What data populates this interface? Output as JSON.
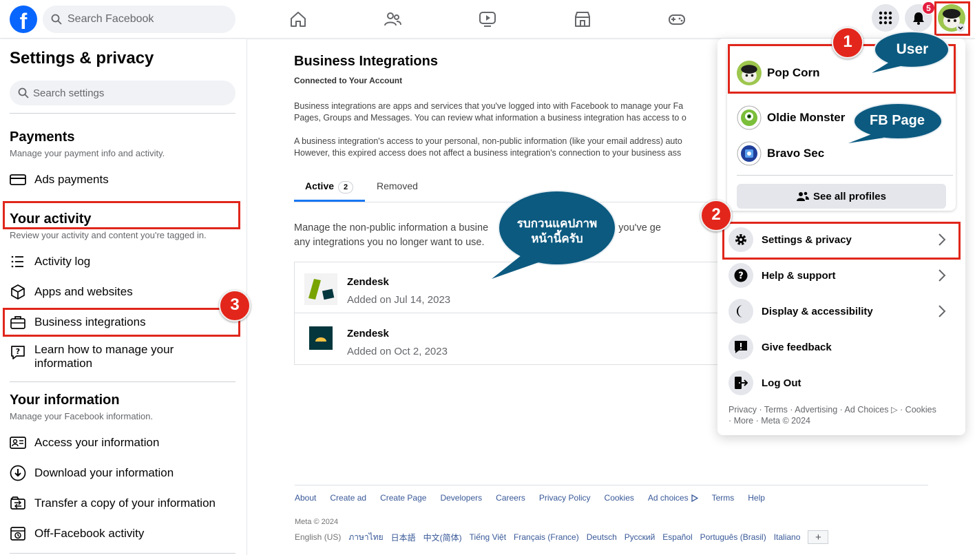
{
  "topbar": {
    "logo": "f",
    "search_placeholder": "Search Facebook",
    "notification_count": "5"
  },
  "sidebar": {
    "title": "Settings & privacy",
    "search_placeholder": "Search settings",
    "payments": {
      "title": "Payments",
      "subtitle": "Manage your payment info and activity.",
      "items": [
        {
          "label": "Ads payments",
          "icon": "card-icon"
        }
      ]
    },
    "activity": {
      "title": "Your activity",
      "subtitle": "Review your activity and content you're tagged in.",
      "items": [
        {
          "label": "Activity log",
          "icon": "list-icon"
        },
        {
          "label": "Apps and websites",
          "icon": "cube-icon"
        },
        {
          "label": "Business integrations",
          "icon": "briefcase-icon"
        },
        {
          "label": "Learn how to manage your information",
          "icon": "question-bubble-icon"
        }
      ]
    },
    "information": {
      "title": "Your information",
      "subtitle": "Manage your Facebook information.",
      "items": [
        {
          "label": "Access your information",
          "icon": "id-card-icon"
        },
        {
          "label": "Download your information",
          "icon": "download-icon"
        },
        {
          "label": "Transfer a copy of your information",
          "icon": "transfer-icon"
        },
        {
          "label": "Off-Facebook activity",
          "icon": "off-facebook-icon"
        }
      ]
    }
  },
  "main": {
    "title": "Business Integrations",
    "subtitle": "Connected to Your Account",
    "para1_line1": "Business integrations are apps and services that you've logged into with Facebook to manage your Fa",
    "para1_line2": "Pages, Groups and Messages. You can review what information a business integration has access to o",
    "para2_line1": "A business integration's access to your personal, non-public information (like your email address) auto",
    "para2_line2": "However, this expired access does not affect a business integration's connection to your business ass",
    "tabs": [
      {
        "label": "Active",
        "count": "2"
      },
      {
        "label": "Removed"
      }
    ],
    "manage_line1": "Manage the non-public information a busine",
    "manage_line1_tail": "s and what you've ge",
    "manage_line2": "any integrations you no longer want to use.",
    "integrations": [
      {
        "name": "Zendesk",
        "added": "Added on Jul 14, 2023"
      },
      {
        "name": "Zendesk",
        "added": "Added on Oct 2, 2023"
      }
    ]
  },
  "footer": {
    "links": [
      "About",
      "Create ad",
      "Create Page",
      "Developers",
      "Careers",
      "Privacy Policy",
      "Cookies",
      "Ad choices",
      "Terms",
      "Help"
    ],
    "meta": "Meta © 2024",
    "languages": [
      "English (US)",
      "ภาษาไทย",
      "日本語",
      "中文(简体)",
      "Tiếng Việt",
      "Français (France)",
      "Deutsch",
      "Русский",
      "Español",
      "Português (Brasil)",
      "Italiano"
    ],
    "plus": "+"
  },
  "menu": {
    "profiles": [
      {
        "name": "Pop Corn"
      },
      {
        "name": "Oldie Monster"
      },
      {
        "name": "Bravo Sec"
      }
    ],
    "see_all": "See all profiles",
    "items": [
      {
        "label": "Settings & privacy",
        "icon": "gear-icon"
      },
      {
        "label": "Help & support",
        "icon": "help-icon"
      },
      {
        "label": "Display & accessibility",
        "icon": "moon-icon"
      },
      {
        "label": "Give feedback",
        "icon": "feedback-icon"
      },
      {
        "label": "Log Out",
        "icon": "logout-icon"
      }
    ],
    "footer_line1": "Privacy · Terms · Advertising · Ad Choices ▷ · Cookies",
    "footer_line2": "· More · Meta © 2024"
  },
  "annotations": {
    "step1": "1",
    "step2": "2",
    "step3": "3",
    "bubble_user": "User",
    "bubble_page": "FB Page",
    "bubble_thai_line1": "รบกวนแคปภาพ",
    "bubble_thai_line2": "หน้านี้ครับ"
  },
  "colors": {
    "brand_blue": "#0866ff",
    "annotation_red": "#e0261b",
    "bubble_teal": "#0c5a80"
  }
}
